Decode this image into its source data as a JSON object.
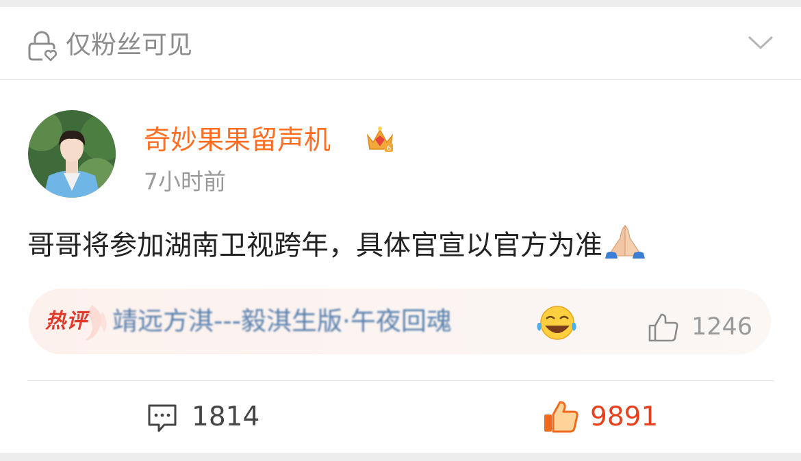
{
  "visibility": {
    "icon": "lock-heart-icon",
    "label": "仅粉丝可见",
    "expand_icon": "chevron-down-icon"
  },
  "post": {
    "author": "奇妙果果留声机",
    "author_badge": "crown-icon",
    "time": "7小时前",
    "text": "哥哥将参加湖南卫视跨年，具体官宣以官方为准",
    "text_emoji": "folded-hands-emoji"
  },
  "hot_comment": {
    "badge": "热评",
    "text": "靖远方淇---毅淇生版·午夜回魂",
    "emoji": "laughing-emoji",
    "like_icon": "thumbs-up-icon",
    "likes": "1246"
  },
  "actions": {
    "comments_icon": "comment-icon",
    "comments": "1814",
    "likes_icon": "thumbs-up-icon",
    "likes": "9891"
  },
  "colors": {
    "author": "#ff6e22",
    "hot_badge": "#e23a2a",
    "hot_text": "#4a76a8",
    "like_active": "#e8401c",
    "muted": "#9a9a9a"
  }
}
